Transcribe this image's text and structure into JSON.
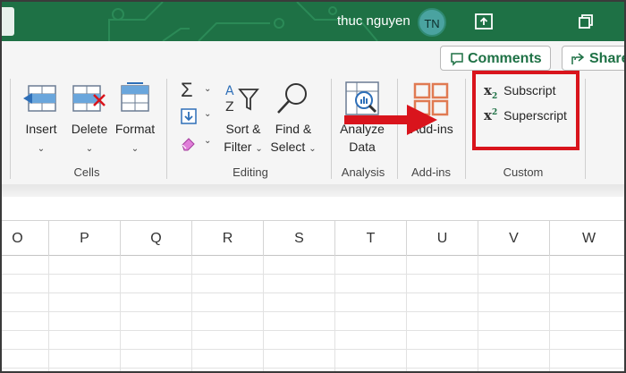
{
  "titlebar": {
    "user_name": "thuc nguyen",
    "avatar_initials": "TN",
    "accent": "#1e7145"
  },
  "header_buttons": {
    "comments_label": "Comments",
    "share_label": "Share"
  },
  "ribbon": {
    "cells": {
      "insert_label": "Insert",
      "delete_label": "Delete",
      "format_label": "Format",
      "group_label": "Cells"
    },
    "editing": {
      "sort_filter_line1": "Sort &",
      "sort_filter_line2": "Filter",
      "find_select_line1": "Find &",
      "find_select_line2": "Select",
      "group_label": "Editing"
    },
    "analysis": {
      "analyze_line1": "Analyze",
      "analyze_line2": "Data",
      "group_label": "Analysis"
    },
    "addins": {
      "addins_label": "Add-ins",
      "group_label": "Add-ins"
    },
    "custom": {
      "subscript_label": "Subscript",
      "superscript_label": "Superscript",
      "group_label": "Custom",
      "highlight_color": "#d9141c"
    }
  },
  "sheet": {
    "columns": [
      "O",
      "P",
      "Q",
      "R",
      "S",
      "T",
      "U",
      "V",
      "W"
    ]
  }
}
